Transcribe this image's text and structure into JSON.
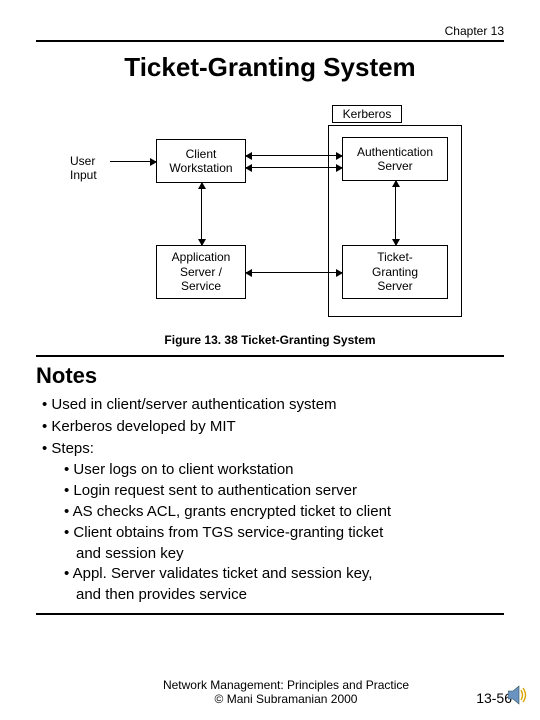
{
  "chapter": "Chapter 13",
  "title": "Ticket-Granting System",
  "diagram": {
    "user_input": "User\nInput",
    "client_ws": "Client\nWorkstation",
    "kerberos_label": "Kerberos",
    "auth_server": "Authentication\nServer",
    "tgs": "Ticket-\nGranting\nServer",
    "app_server": "Application\nServer /\nService",
    "caption": "Figure 13. 38 Ticket-Granting System"
  },
  "notes_heading": "Notes",
  "bullets": {
    "b0": "Used in client/server authentication system",
    "b1": "Kerberos developed by MIT",
    "b2": "Steps:",
    "s0": "User logs on to client workstation",
    "s1": "Login request sent to authentication server",
    "s2": "AS checks ACL, grants encrypted ticket to client",
    "s3": "Client obtains from TGS service-granting ticket",
    "s3c": "and session key",
    "s4": "Appl. Server validates ticket and session key,",
    "s4c": "and then provides service"
  },
  "footer": {
    "line1": "Network Management: Principles and Practice",
    "line2": "©  Mani Subramanian 2000",
    "page": "13-56"
  }
}
